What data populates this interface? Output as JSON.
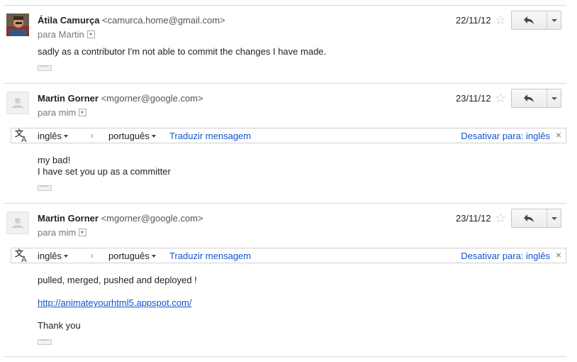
{
  "messages": [
    {
      "sender_name": "Átila Camurça",
      "sender_email": "<camurca.home@gmail.com>",
      "recipient": "para Martin",
      "date": "22/11/12",
      "body": [
        "sadly as a contributor I'm not able to commit the changes I have made."
      ]
    },
    {
      "sender_name": "Martin Gorner",
      "sender_email": "<mgorner@google.com>",
      "recipient": "para mim",
      "date": "23/11/12",
      "translate": {
        "source_lang": "inglês",
        "arrow": "›",
        "target_lang": "português",
        "translate_link": "Traduzir mensagem",
        "disable_link": "Desativar para: inglês",
        "close": "×"
      },
      "body": [
        "my bad!",
        "I have set you up as a committer"
      ]
    },
    {
      "sender_name": "Martin Gorner",
      "sender_email": "<mgorner@google.com>",
      "recipient": "para mim",
      "date": "23/11/12",
      "translate": {
        "source_lang": "inglês",
        "arrow": "›",
        "target_lang": "português",
        "translate_link": "Traduzir mensagem",
        "disable_link": "Desativar para: inglês",
        "close": "×"
      },
      "body": [
        "pulled, merged, pushed and deployed !",
        "http://animateyourhtml5.appspot.com/",
        "Thank you"
      ]
    }
  ],
  "icons": {
    "star": "☆",
    "reply": "reply-icon",
    "more": "chevron-down-icon",
    "translate": "translate-icon"
  },
  "colors": {
    "link": "#1155cc",
    "divider": "#d8d8d8"
  }
}
